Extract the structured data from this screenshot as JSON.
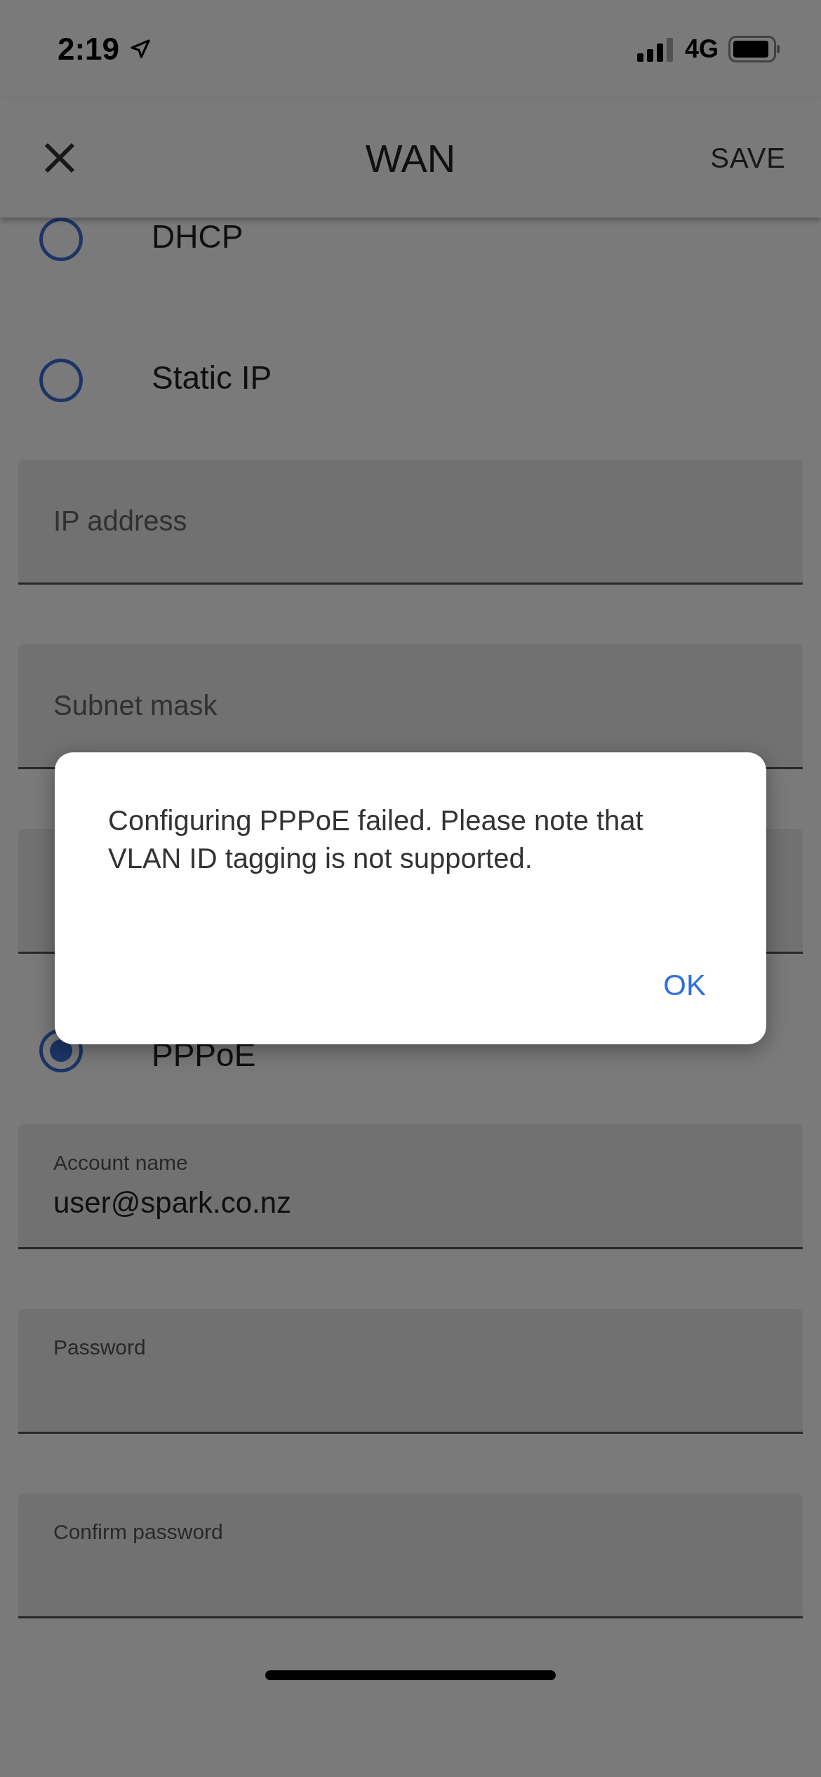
{
  "status_bar": {
    "time": "2:19",
    "network": "4G"
  },
  "header": {
    "title": "WAN",
    "action": "SAVE"
  },
  "connection_types": [
    {
      "label": "DHCP",
      "selected": false
    },
    {
      "label": "Static IP",
      "selected": false
    }
  ],
  "static_fields": [
    {
      "kind": "text_field",
      "placeholder": "IP address"
    },
    {
      "kind": "text_field",
      "placeholder": "Subnet mask"
    },
    {
      "kind": "text_field"
    }
  ],
  "pppoe_option": {
    "label": "PPPoE",
    "selected": true
  },
  "pppoe_fields": [
    {
      "label": "Account name",
      "value": "user@spark.co.nz"
    },
    {
      "label": "Password"
    },
    {
      "label": "Confirm password"
    }
  ],
  "dialog": {
    "message": "Configuring PPPoE failed. Please note that VLAN ID tagging is not supported.",
    "button": "OK"
  }
}
